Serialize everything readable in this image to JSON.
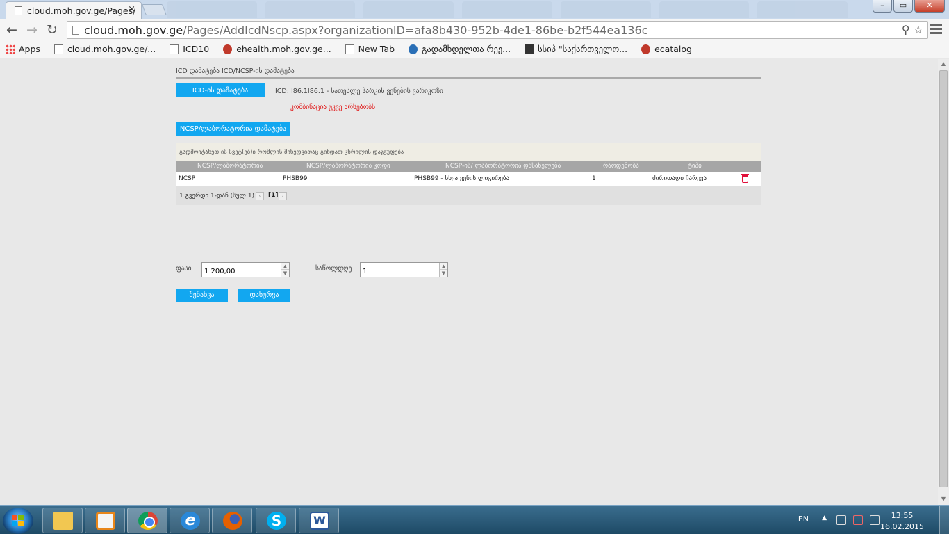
{
  "browser": {
    "tab_title": "cloud.moh.gov.ge/Pages/",
    "tab_close": "×",
    "url_host": "cloud.moh.gov.ge",
    "url_path": "/Pages/AddIcdNscp.aspx?organizationID=afa8b430-952b-4de1-86be-b2f544ea136c",
    "bookmarks": [
      {
        "label": "Apps",
        "icon": "apps-icon"
      },
      {
        "label": "cloud.moh.gov.ge/...",
        "icon": "page-icon"
      },
      {
        "label": "ICD10",
        "icon": "page-icon"
      },
      {
        "label": "ehealth.moh.gov.ge...",
        "icon": "emblem-icon"
      },
      {
        "label": "New Tab",
        "icon": "page-icon"
      },
      {
        "label": "გადამხდელთა რეე...",
        "icon": "globe-icon"
      },
      {
        "label": "სსიპ \"საქართველო...",
        "icon": "building-icon"
      },
      {
        "label": "ecatalog",
        "icon": "ecatalog-icon"
      }
    ]
  },
  "page": {
    "breadcrumb": "ICD დამატება ICD/NCSP-ის დამატება",
    "add_icd_button": "ICD-ის დამატება",
    "icd_info": "ICD: I86.1I86.1 - სათესლე ჰარკის ვენების ვარიკოზი",
    "warning": "კომბინაცია უკვე არსებობს",
    "add_ncsp_button": "NCSP/ლაბორატორია დამატება",
    "grid_hint": "გადმოიტანეთ ის სვეტ(ებ)ი რომლის მიხედვითაც გინდათ ცხრილის დაჯგუფება",
    "columns": [
      "NCSP/ლაბორატორია",
      "NCSP/ლაბორატორია კოდი",
      "NCSP-ის/ ლაბორატორია დასახელება",
      "რაოდენობა",
      "ტიპი"
    ],
    "rows": [
      {
        "kind": "NCSP",
        "code": "PHSB99",
        "name": "PHSB99 - სხვა ვენის ლიგირება",
        "qty": "1",
        "type": "ძირითადი ჩარევა"
      }
    ],
    "pager_text": "1 გვერდი 1-დან (სულ 1)",
    "pager_prev": "‹",
    "pager_next": "›",
    "pager_current": "[1]",
    "price_label": "ფასი",
    "price_value": "1 200,00",
    "duration_label": "საწოლდღე",
    "duration_value": "1",
    "save_button": "შენახვა",
    "close_button": "დახურვა"
  },
  "taskbar": {
    "lang": "EN",
    "time": "13:55",
    "date": "16.02.2015"
  },
  "colors": {
    "accent_blue": "#12a7f0",
    "warning_red": "#e01010",
    "delete_red": "#e0103a",
    "grid_header": "#a6a6a6"
  }
}
